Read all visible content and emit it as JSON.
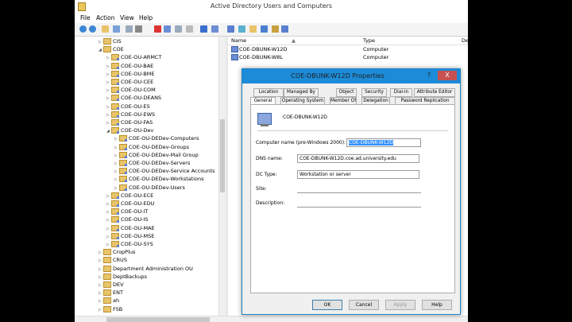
{
  "window": {
    "title": "Active Directory Users and Computers"
  },
  "menu": [
    "File",
    "Action",
    "View",
    "Help"
  ],
  "tree": [
    {
      "label": "CIS",
      "indent": 0,
      "type": "folder"
    },
    {
      "label": "COE",
      "indent": 0,
      "type": "folder",
      "expanded": true
    },
    {
      "label": "COE-OU-ARMCT",
      "indent": 1,
      "type": "ou"
    },
    {
      "label": "COE-OU-BAE",
      "indent": 1,
      "type": "ou"
    },
    {
      "label": "COE-OU-BME",
      "indent": 1,
      "type": "ou"
    },
    {
      "label": "COE-OU-CEE",
      "indent": 1,
      "type": "ou"
    },
    {
      "label": "COE-OU-COM",
      "indent": 1,
      "type": "ou"
    },
    {
      "label": "COE-OU-DEANS",
      "indent": 1,
      "type": "ou"
    },
    {
      "label": "COE-OU-ES",
      "indent": 1,
      "type": "ou"
    },
    {
      "label": "COE-OU-EWS",
      "indent": 1,
      "type": "ou"
    },
    {
      "label": "COE-OU-FAS",
      "indent": 1,
      "type": "ou"
    },
    {
      "label": "COE-OU-Dev",
      "indent": 1,
      "type": "ou",
      "expanded": true
    },
    {
      "label": "COE-OU-DEDev-Computers",
      "indent": 2,
      "type": "ou"
    },
    {
      "label": "COE-OU-DEDev-Groups",
      "indent": 2,
      "type": "ou"
    },
    {
      "label": "COE-OU-DEDev-Mail Group",
      "indent": 2,
      "type": "ou"
    },
    {
      "label": "COE-OU-DEDev-Servers",
      "indent": 2,
      "type": "ou"
    },
    {
      "label": "COE-OU-DEDev-Service Accounts",
      "indent": 2,
      "type": "ou"
    },
    {
      "label": "COE-OU-DEDev-Workstations",
      "indent": 2,
      "type": "ou"
    },
    {
      "label": "COE-OU-DEDev-Users",
      "indent": 2,
      "type": "ou"
    },
    {
      "label": "COE-OU-ECE",
      "indent": 1,
      "type": "ou"
    },
    {
      "label": "COE-OU-EDU",
      "indent": 1,
      "type": "ou"
    },
    {
      "label": "COE-OU-IT",
      "indent": 1,
      "type": "ou"
    },
    {
      "label": "COE-OU-IS",
      "indent": 1,
      "type": "ou"
    },
    {
      "label": "COE-OU-MAE",
      "indent": 1,
      "type": "ou"
    },
    {
      "label": "COE-OU-MSE",
      "indent": 1,
      "type": "ou"
    },
    {
      "label": "COE-OU-SYS",
      "indent": 1,
      "type": "ou"
    },
    {
      "label": "CropPlus",
      "indent": 0,
      "type": "folder"
    },
    {
      "label": "CRUS",
      "indent": 0,
      "type": "folder"
    },
    {
      "label": "Department Administration OU",
      "indent": 0,
      "type": "folder"
    },
    {
      "label": "DeptBackups",
      "indent": 0,
      "type": "folder"
    },
    {
      "label": "DEV",
      "indent": 0,
      "type": "folder"
    },
    {
      "label": "ENT",
      "indent": 0,
      "type": "folder"
    },
    {
      "label": "ah",
      "indent": 0,
      "type": "folder"
    },
    {
      "label": "FSB",
      "indent": 0,
      "type": "folder"
    }
  ],
  "list": {
    "columns": {
      "name": "Name",
      "type": "Type",
      "desc": "De"
    },
    "rows": [
      {
        "name": "COE-DBUNK-W12D",
        "type": "Computer"
      },
      {
        "name": "COE-DBUNK-W8L",
        "type": "Computer"
      }
    ]
  },
  "dialog": {
    "title": "COE-DBUNK-W12D Properties",
    "help": "?",
    "close": "X",
    "tabs_row1": [
      "Location",
      "Managed By",
      "Object",
      "Security",
      "Dial-in",
      "Attribute Editor"
    ],
    "tabs_row2": [
      "General",
      "Operating System",
      "Member Of",
      "Delegation",
      "Password Replication"
    ],
    "object_name": "COE-DBUNK-W12D",
    "fields": {
      "computer_name_label": "Computer name (pre-Windows 2000):",
      "computer_name_value": "COE-DBUNK-W12D",
      "dns_label": "DNS name:",
      "dns_value": "COE-DBUNK-W12D.coe.ad.university.edu",
      "dc_type_label": "DC Type:",
      "dc_type_value": "Workstation or server",
      "site_label": "Site:",
      "description_label": "Description:"
    },
    "buttons": {
      "ok": "OK",
      "cancel": "Cancel",
      "apply": "Apply",
      "help": "Help"
    }
  }
}
